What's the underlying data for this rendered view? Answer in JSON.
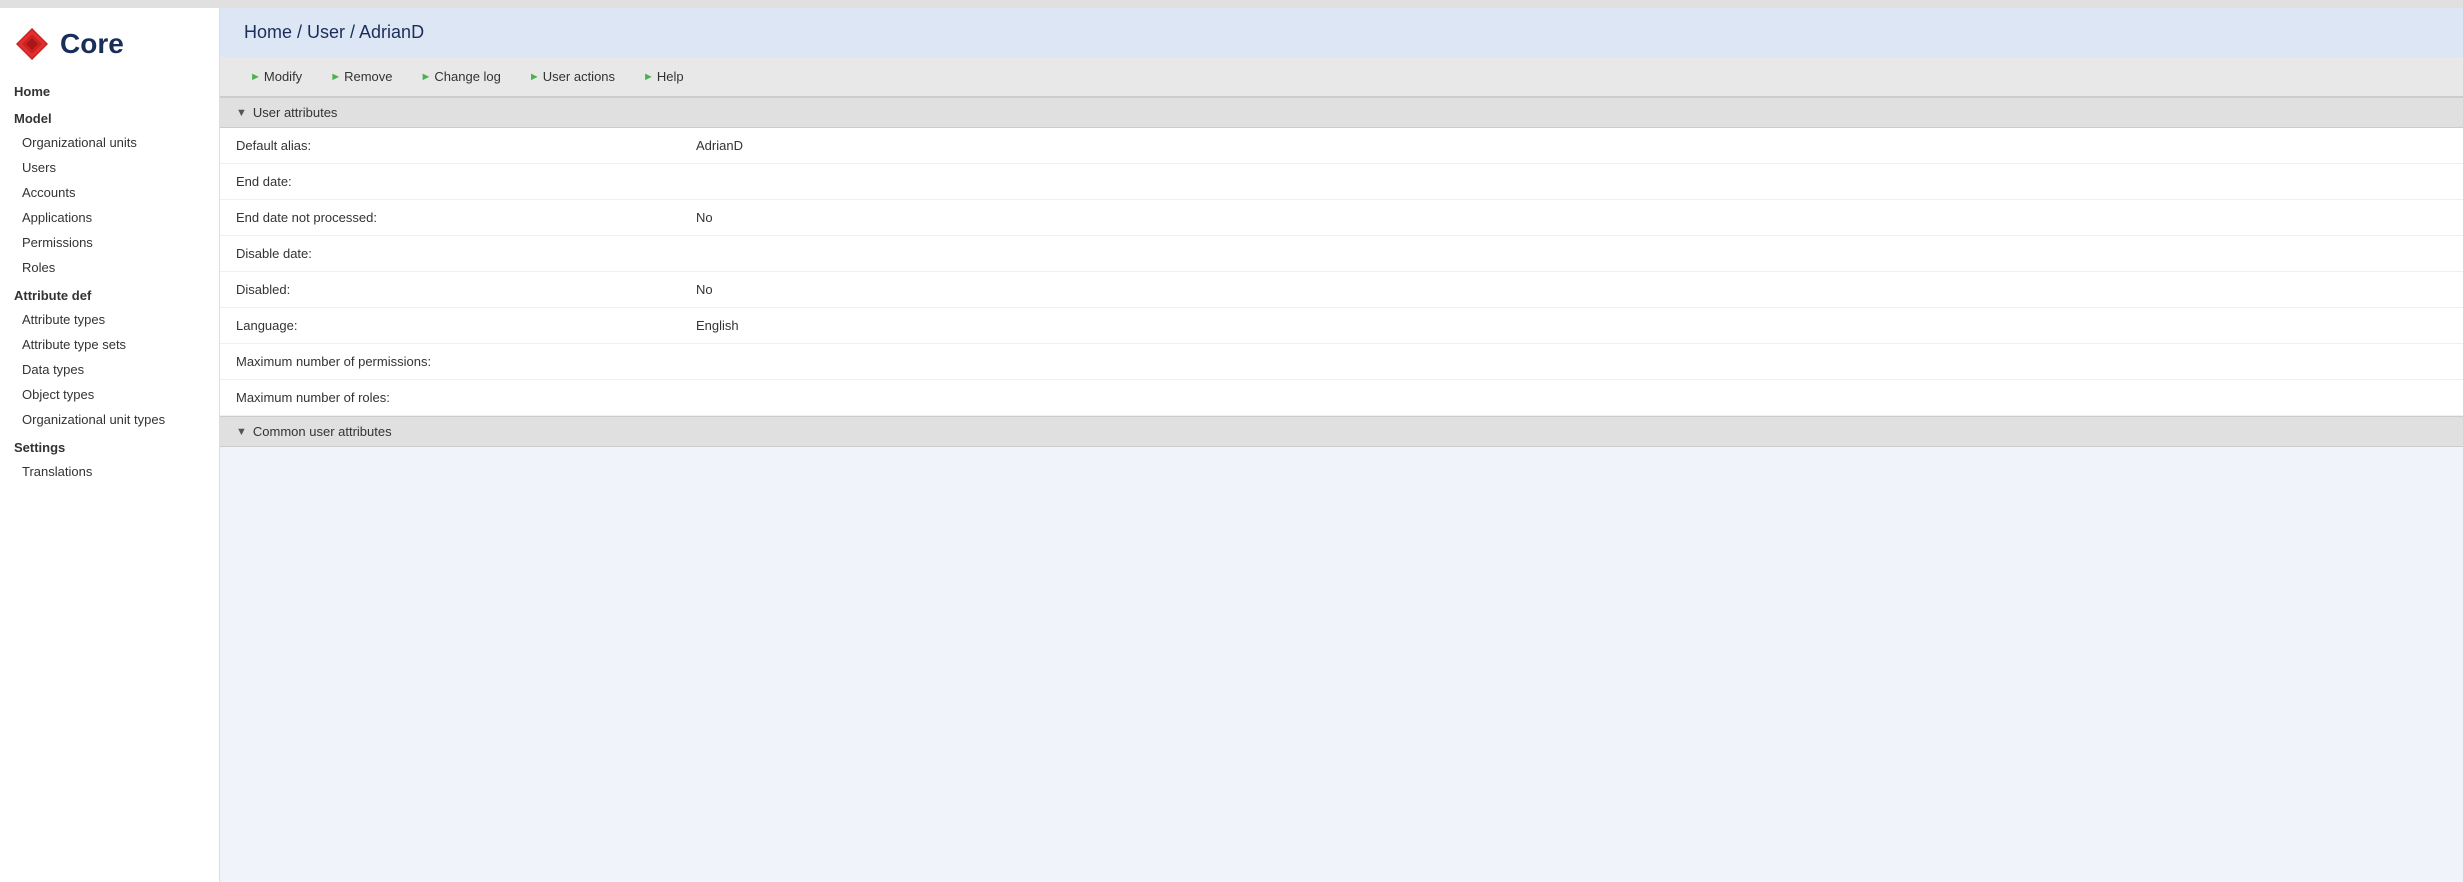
{
  "app": {
    "title": "Core"
  },
  "sidebar": {
    "logo_text": "Core",
    "home_label": "Home",
    "sections": [
      {
        "header": "Model",
        "items": [
          {
            "label": "Organizational units",
            "name": "organizational-units"
          },
          {
            "label": "Users",
            "name": "users"
          },
          {
            "label": "Accounts",
            "name": "accounts"
          },
          {
            "label": "Applications",
            "name": "applications"
          },
          {
            "label": "Permissions",
            "name": "permissions"
          },
          {
            "label": "Roles",
            "name": "roles"
          }
        ]
      },
      {
        "header": "Attribute def",
        "items": [
          {
            "label": "Attribute types",
            "name": "attribute-types"
          },
          {
            "label": "Attribute type sets",
            "name": "attribute-type-sets"
          },
          {
            "label": "Data types",
            "name": "data-types"
          },
          {
            "label": "Object types",
            "name": "object-types"
          },
          {
            "label": "Organizational unit types",
            "name": "organizational-unit-types"
          }
        ]
      },
      {
        "header": "Settings",
        "items": [
          {
            "label": "Translations",
            "name": "translations"
          }
        ]
      }
    ]
  },
  "breadcrumb": {
    "text": "Home / User / AdrianD"
  },
  "action_bar": {
    "buttons": [
      {
        "label": "Modify",
        "name": "modify-button"
      },
      {
        "label": "Remove",
        "name": "remove-button"
      },
      {
        "label": "Change log",
        "name": "change-log-button"
      },
      {
        "label": "User actions",
        "name": "user-actions-button"
      },
      {
        "label": "Help",
        "name": "help-button"
      }
    ]
  },
  "user_attributes_section": {
    "header": "User attributes",
    "fields": [
      {
        "label": "Default alias:",
        "value": "AdrianD",
        "name": "default-alias"
      },
      {
        "label": "End date:",
        "value": "",
        "name": "end-date"
      },
      {
        "label": "End date not processed:",
        "value": "No",
        "name": "end-date-not-processed"
      },
      {
        "label": "Disable date:",
        "value": "",
        "name": "disable-date"
      },
      {
        "label": "Disabled:",
        "value": "No",
        "name": "disabled"
      },
      {
        "label": "Language:",
        "value": "English",
        "name": "language"
      },
      {
        "label": "Maximum number of permissions:",
        "value": "",
        "name": "max-permissions"
      },
      {
        "label": "Maximum number of roles:",
        "value": "",
        "name": "max-roles"
      }
    ]
  },
  "common_user_attributes_section": {
    "header": "Common user attributes"
  }
}
